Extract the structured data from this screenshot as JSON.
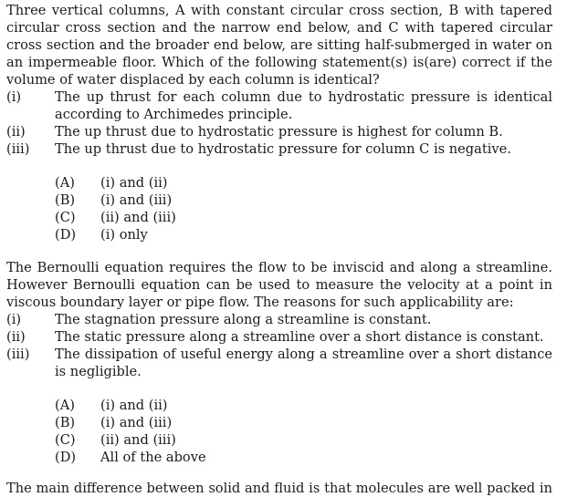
{
  "questions": [
    {
      "stem_lines": [
        "Three vertical columns, A with constant circular cross section, B with tapered",
        "circular cross section and the narrow end below, and C with tapered circular",
        "cross section and the broader end below, are sitting half-submerged in water on",
        "an impermeable floor. Which of the following statement(s) is(are) correct if the",
        "volume of water displaced by each column is identical?"
      ],
      "statements": [
        {
          "num": "(i)",
          "lines": [
            "The up thrust for each column due to hydrostatic pressure is identical",
            "according to Archimedes principle."
          ]
        },
        {
          "num": "(ii)",
          "lines": [
            "The up thrust due to hydrostatic pressure is highest for column B."
          ]
        },
        {
          "num": "(iii)",
          "lines": [
            "The up thrust due to hydrostatic pressure for column C is negative."
          ]
        }
      ],
      "options": [
        {
          "label": "(A)",
          "text": "(i) and (ii)"
        },
        {
          "label": "(B)",
          "text": "(i) and (iii)"
        },
        {
          "label": "(C)",
          "text": "(ii) and (iii)"
        },
        {
          "label": "(D)",
          "text": "(i) only"
        }
      ]
    },
    {
      "stem_lines": [
        "The Bernoulli equation requires the flow to be inviscid and along a streamline.",
        "However Bernoulli equation can be used to measure the velocity at a point in",
        "viscous boundary layer or pipe flow. The reasons for such applicability are:"
      ],
      "statements": [
        {
          "num": "(i)",
          "lines": [
            "The stagnation pressure along a streamline is constant."
          ]
        },
        {
          "num": "(ii)",
          "lines": [
            "The static pressure along a streamline over a short distance is constant."
          ]
        },
        {
          "num": "(iii)",
          "lines": [
            "The dissipation of useful energy along a streamline over a short distance",
            "is negligible."
          ]
        }
      ],
      "options": [
        {
          "label": "(A)",
          "text": "(i) and (ii)"
        },
        {
          "label": "(B)",
          "text": "(i) and (iii)"
        },
        {
          "label": "(C)",
          "text": "(ii) and (iii)"
        },
        {
          "label": "(D)",
          "text": "All of the above"
        }
      ]
    }
  ],
  "clipped_line": "The main difference between solid and fluid is that molecules are well packed in"
}
